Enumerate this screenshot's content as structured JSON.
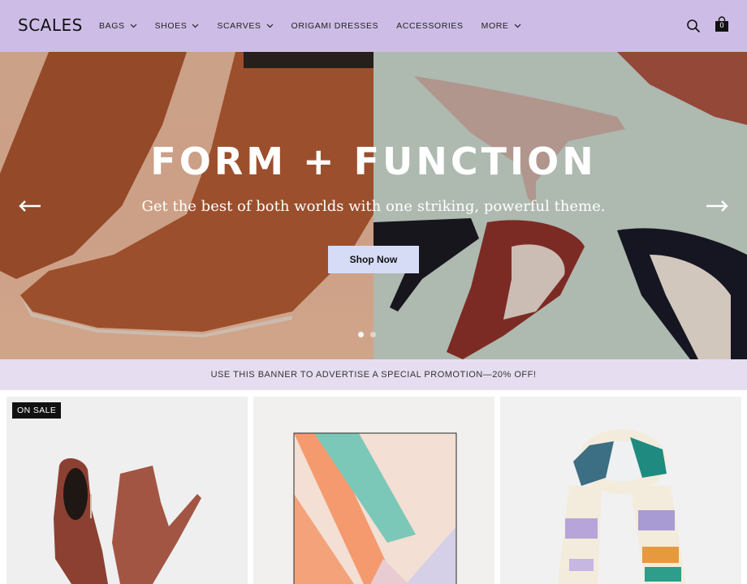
{
  "brand": {
    "logo": "SCALES"
  },
  "nav": [
    {
      "label": "BAGS",
      "dropdown": true
    },
    {
      "label": "SHOES",
      "dropdown": true
    },
    {
      "label": "SCARVES",
      "dropdown": true
    },
    {
      "label": "ORIGAMI DRESSES",
      "dropdown": false
    },
    {
      "label": "ACCESSORIES",
      "dropdown": false
    },
    {
      "label": "MORE",
      "dropdown": true
    }
  ],
  "header": {
    "cart_count": "0",
    "search_icon": "search-icon",
    "cart_icon": "shopping-bag-icon"
  },
  "hero": {
    "title": "FORM + FUNCTION",
    "subtitle": "Get the best of both worlds with one striking, powerful theme.",
    "button": "Shop Now",
    "slides": 2,
    "active_slide": 1
  },
  "promo": {
    "text": "USE THIS BANNER TO ADVERTISE A SPECIAL PROMOTION—20% OFF!"
  },
  "products": [
    {
      "badge": "ON SALE",
      "image": "suede-ankle-boots"
    },
    {
      "badge": "",
      "image": "geometric-silk-scarf"
    },
    {
      "badge": "",
      "image": "watercolor-scarf"
    }
  ],
  "colors": {
    "header_bg": "#cdbde6",
    "promo_bg": "#e6def0",
    "button_bg": "#d7dcf6"
  }
}
